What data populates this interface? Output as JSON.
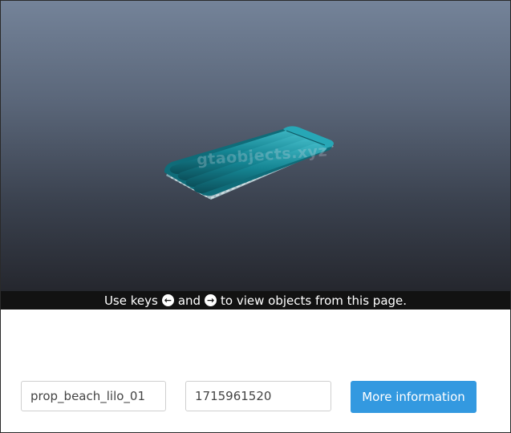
{
  "viewer": {
    "watermark": "gtaobjects.xyz",
    "hint": {
      "prefix": "Use keys",
      "left_key": "←",
      "middle": "and",
      "right_key": "→",
      "suffix": "to view objects from this page."
    }
  },
  "form": {
    "object_name": "prop_beach_lilo_01",
    "object_hash": "1715961520",
    "more_info_label": "More information"
  },
  "colors": {
    "button": "#3399e0",
    "hint_bar": "#121212",
    "lilo": "#1a8a9a"
  }
}
